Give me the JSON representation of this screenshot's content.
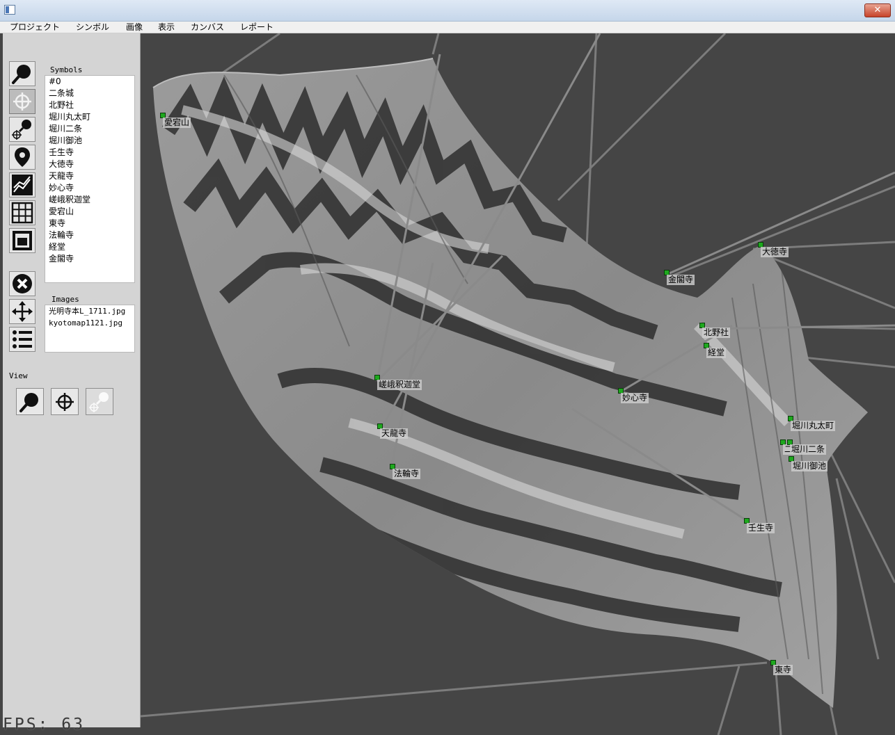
{
  "window": {
    "close_label": "✕"
  },
  "menu": [
    "プロジェクト",
    "シンボル",
    "画像",
    "表示",
    "カンバス",
    "レポート"
  ],
  "tools": [
    {
      "name": "zoom-search-tool-button",
      "icon": "magnifier-icon",
      "selected": false
    },
    {
      "name": "crosshair-tool-button",
      "icon": "crosshair-icon",
      "selected": true
    },
    {
      "name": "zoom-point-tool-button",
      "icon": "zoom-point-icon",
      "selected": false
    },
    {
      "name": "map-pin-tool-button",
      "icon": "map-pin-icon",
      "selected": false
    },
    {
      "name": "graph-tool-button",
      "icon": "line-graph-icon",
      "selected": false
    },
    {
      "name": "grid-tool-button",
      "icon": "grid-icon",
      "selected": false
    },
    {
      "name": "frame-tool-button",
      "icon": "frame-icon",
      "selected": false
    },
    {
      "name": "delete-tool-button",
      "icon": "x-circle-icon",
      "selected": false
    },
    {
      "name": "move-tool-button",
      "icon": "move-arrows-icon",
      "selected": false
    },
    {
      "name": "list-tool-button",
      "icon": "bullet-list-icon",
      "selected": false
    }
  ],
  "symbols": {
    "label": "Symbols",
    "items": [
      "#0",
      "二条城",
      "北野社",
      "堀川丸太町",
      "堀川二条",
      "堀川御池",
      "壬生寺",
      "大徳寺",
      "天龍寺",
      "妙心寺",
      "嵯峨釈迦堂",
      "愛宕山",
      "東寺",
      "法輪寺",
      "経堂",
      "金閣寺"
    ]
  },
  "images": {
    "label": "Images",
    "items": [
      "光明寺本L_1711.jpg",
      "kyotomap1121.jpg"
    ]
  },
  "view": {
    "label": "View",
    "buttons": [
      {
        "name": "view-zoom-button",
        "icon": "magnifier-icon"
      },
      {
        "name": "view-crosshair-button",
        "icon": "crosshair-icon"
      },
      {
        "name": "view-zoom-point-button",
        "icon": "zoom-point-icon-disabled"
      }
    ]
  },
  "markers": [
    "愛宕山",
    "金閣寺",
    "大徳寺",
    "北野社",
    "経堂",
    "嵯峨釈迦堂",
    "妙心寺",
    "天龍寺",
    "法輪寺",
    "堀川丸太町",
    "二",
    "堀川二条",
    "堀川御池",
    "壬生寺",
    "東寺"
  ],
  "fps_text": "FPS: 63",
  "colors": {
    "viewport_bg": "#454545",
    "marker": "#1ea81e",
    "panel_bg": "#d4d4d4"
  }
}
